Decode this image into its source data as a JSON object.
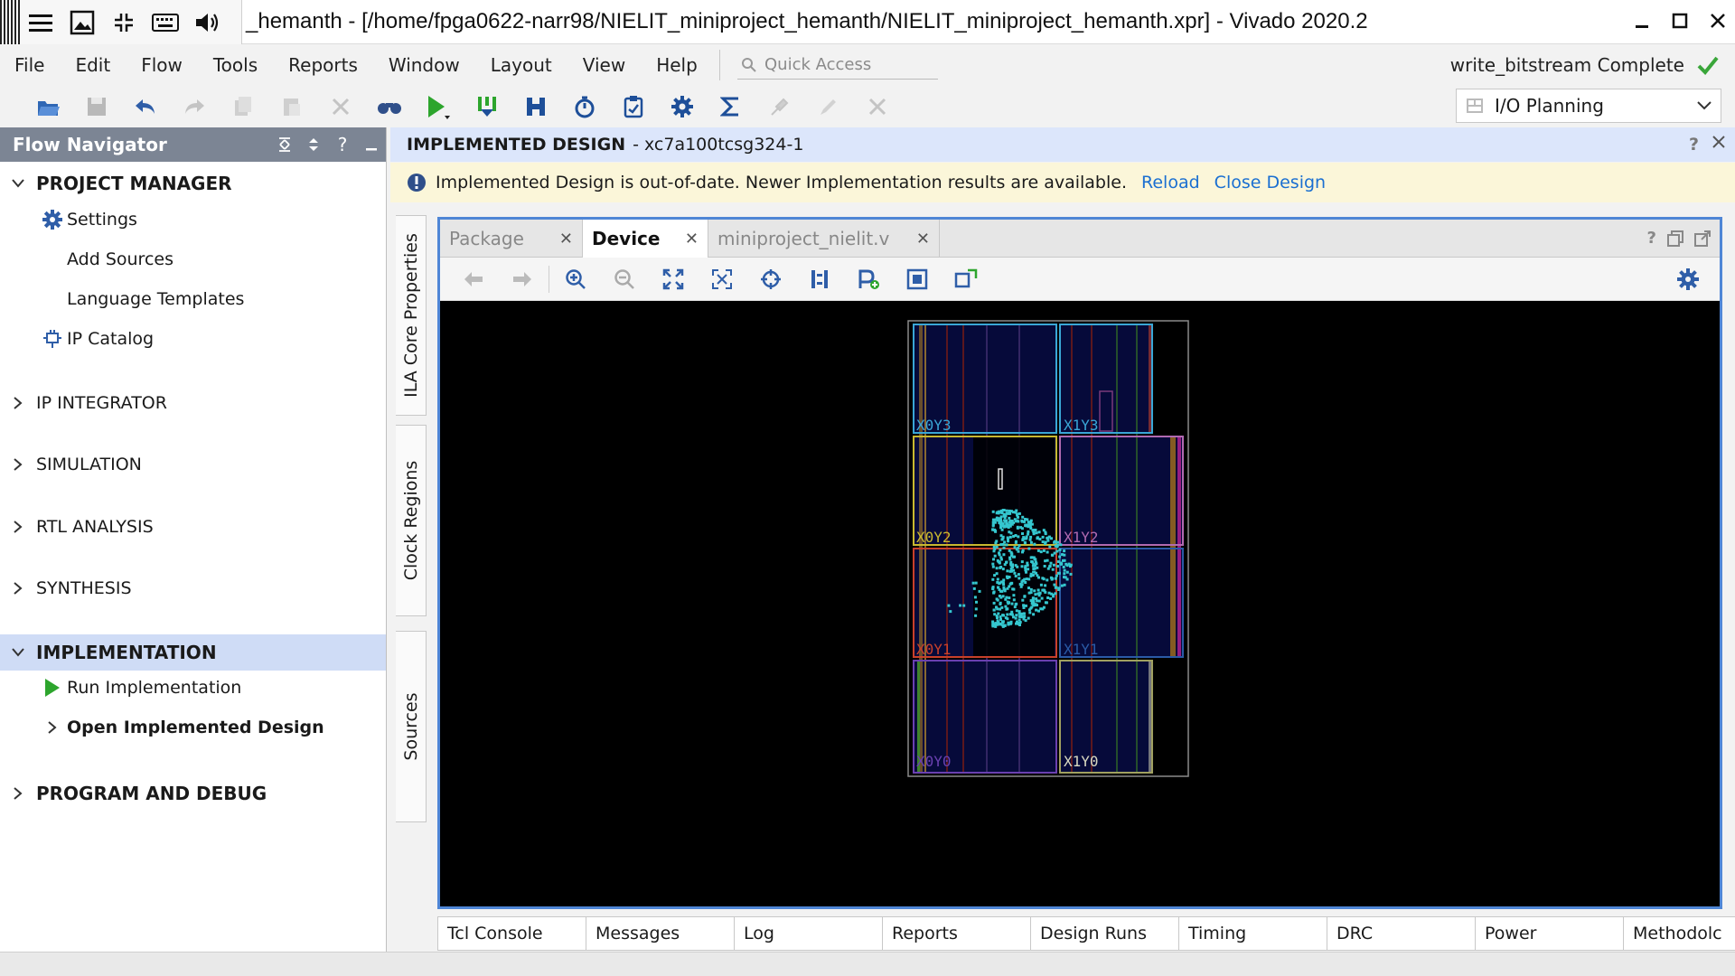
{
  "window": {
    "title": "_hemanth - [/home/fpga0622-narr98/NIELIT_miniproject_hemanth/NIELIT_miniproject_hemanth.xpr] - Vivado 2020.2"
  },
  "menu": [
    "File",
    "Edit",
    "Flow",
    "Tools",
    "Reports",
    "Window",
    "Layout",
    "View",
    "Help"
  ],
  "quick_access": {
    "placeholder": "Quick Access"
  },
  "status": {
    "text": "write_bitstream Complete",
    "color": "#3aa63a"
  },
  "layout_select": {
    "value": "I/O Planning"
  },
  "flow_navigator": {
    "title": "Flow Navigator",
    "project_manager": {
      "label": "PROJECT MANAGER",
      "items": [
        "Settings",
        "Add Sources",
        "Language Templates",
        "IP Catalog"
      ]
    },
    "ip_integrator": "IP INTEGRATOR",
    "simulation": "SIMULATION",
    "rtl_analysis": "RTL ANALYSIS",
    "synthesis": "SYNTHESIS",
    "implementation": {
      "label": "IMPLEMENTATION",
      "items": [
        "Run Implementation",
        "Open Implemented Design"
      ]
    },
    "program_debug": "PROGRAM AND DEBUG"
  },
  "side_tabs": [
    "ILA Core Properties",
    "Clock Regions",
    "Sources"
  ],
  "impl_header": {
    "title": "IMPLEMENTED DESIGN",
    "part": "- xc7a100tcsg324-1"
  },
  "banner": {
    "message": "Implemented Design is out-of-date. Newer Implementation results are available.",
    "reload": "Reload",
    "close_design": "Close Design"
  },
  "device_tabs": [
    "Package",
    "Device",
    "miniproject_nielit.v"
  ],
  "clock_regions": [
    "X0Y3",
    "X1Y3",
    "X0Y2",
    "X1Y2",
    "X0Y1",
    "X1Y1",
    "X0Y0",
    "X1Y0"
  ],
  "bottom_tabs": [
    "Tcl Console",
    "Messages",
    "Log",
    "Reports",
    "Design Runs",
    "Timing",
    "DRC",
    "Power",
    "Methodolc"
  ],
  "colors": {
    "accent": "#4f86d6",
    "header_bg": "#7c8594",
    "selected_bg": "#cfdcf6",
    "link": "#1a6fd1",
    "placed_cells": "#35c7cf"
  }
}
